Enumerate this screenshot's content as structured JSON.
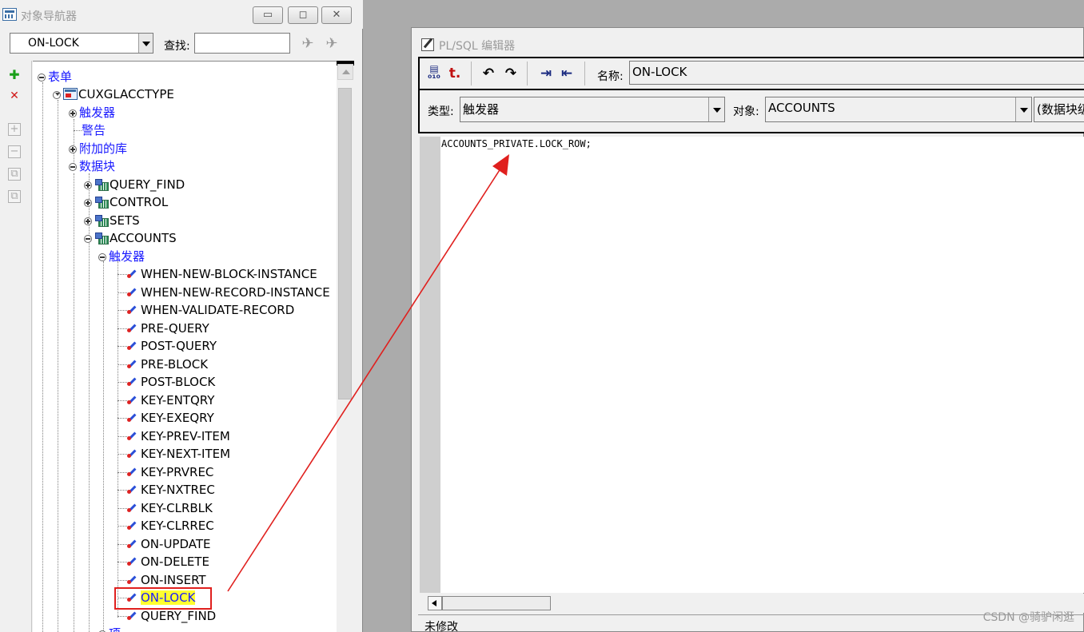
{
  "navigator": {
    "title": "对象导航器",
    "window_buttons": {
      "minimize": "▭",
      "maximize": "◻",
      "close": "✕"
    },
    "object_selector": "ON-LOCK",
    "find_label": "查找:",
    "find_value": "",
    "left_toolbar": {
      "add": "✚",
      "delete": "✕",
      "expand": "+",
      "collapse": "−"
    },
    "tree": {
      "root": "表单",
      "form": "CUXGLACCTYPE",
      "form_children": [
        "触发器",
        "警告",
        "附加的库",
        "数据块"
      ],
      "blocks": [
        "QUERY_FIND",
        "CONTROL",
        "SETS",
        "ACCOUNTS"
      ],
      "accounts_triggers_label": "触发器",
      "triggers": [
        "WHEN-NEW-BLOCK-INSTANCE",
        "WHEN-NEW-RECORD-INSTANCE",
        "WHEN-VALIDATE-RECORD",
        "PRE-QUERY",
        "POST-QUERY",
        "PRE-BLOCK",
        "POST-BLOCK",
        "KEY-ENTQRY",
        "KEY-EXEQRY",
        "KEY-PREV-ITEM",
        "KEY-NEXT-ITEM",
        "KEY-PRVREC",
        "KEY-NXTREC",
        "KEY-CLRBLK",
        "KEY-CLRREC",
        "ON-UPDATE",
        "ON-DELETE",
        "ON-INSERT",
        "ON-LOCK",
        "QUERY_FIND"
      ],
      "selected_trigger": "ON-LOCK",
      "partial_next": "项"
    }
  },
  "editor": {
    "title": "PL/SQL 编辑器",
    "toolbar_icons": [
      "compile-icon",
      "revert-icon",
      "undo-icon",
      "redo-icon",
      "indent-icon",
      "outdent-icon"
    ],
    "name_label": "名称:",
    "name_value": "ON-LOCK",
    "type_label": "类型:",
    "type_value": "触发器",
    "object_label": "对象:",
    "object_value": "ACCOUNTS",
    "level_value": "(数据块级",
    "code": "ACCOUNTS_PRIVATE.LOCK_ROW;",
    "status": "未修改"
  },
  "watermark": "CSDN @骑驴闲逛",
  "colors": {
    "highlight_box": "#e0201e",
    "selection_fill": "#ffff30",
    "tree_category": "#1a1aff",
    "arrow": "#e0201e"
  }
}
